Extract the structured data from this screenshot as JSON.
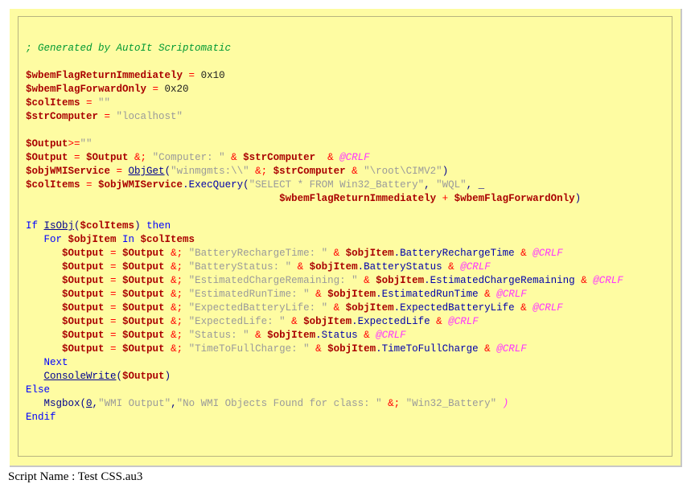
{
  "colors": {
    "panel_background": "#fefca2",
    "comment": "#009933",
    "variable": "#aa0000",
    "operator": "#ff0000",
    "string": "#9a9a9a",
    "keyword": "#0000ff",
    "function": "#000090",
    "property": "#0000aa",
    "macro": "#ff33ff"
  },
  "code_lines": [
    [
      {
        "t": "; Generated by AutoIt Scriptomatic",
        "c": "cm"
      }
    ],
    [],
    [
      {
        "t": "$wbemFlagReturnImmediately",
        "c": "v"
      },
      {
        "t": " = ",
        "c": "o"
      },
      {
        "t": "0x10",
        "c": "n"
      }
    ],
    [
      {
        "t": "$wbemFlagForwardOnly",
        "c": "v"
      },
      {
        "t": " = ",
        "c": "o"
      },
      {
        "t": "0x20",
        "c": "n"
      }
    ],
    [
      {
        "t": "$colItems",
        "c": "v"
      },
      {
        "t": " = ",
        "c": "o"
      },
      {
        "t": "\"\"",
        "c": "s"
      }
    ],
    [
      {
        "t": "$strComputer",
        "c": "v"
      },
      {
        "t": " = ",
        "c": "o"
      },
      {
        "t": "\"localhost\"",
        "c": "s"
      }
    ],
    [],
    [
      {
        "t": "$Output",
        "c": "v"
      },
      {
        "t": ">=",
        "c": "o"
      },
      {
        "t": "\"\"",
        "c": "s"
      }
    ],
    [
      {
        "t": "$Output",
        "c": "v"
      },
      {
        "t": " = ",
        "c": "o"
      },
      {
        "t": "$Output",
        "c": "v"
      },
      {
        "t": " &; ",
        "c": "o"
      },
      {
        "t": "\"Computer: \"",
        "c": "s"
      },
      {
        "t": " & ",
        "c": "o"
      },
      {
        "t": "$strComputer",
        "c": "v"
      },
      {
        "t": "  & ",
        "c": "o"
      },
      {
        "t": "@CRLF",
        "c": "mc"
      }
    ],
    [
      {
        "t": "$objWMIService",
        "c": "v"
      },
      {
        "t": " = ",
        "c": "o"
      },
      {
        "t": "ObjGet",
        "c": "fn"
      },
      {
        "t": "(",
        "c": "p"
      },
      {
        "t": "\"winmgmts:\\\\\"",
        "c": "s"
      },
      {
        "t": " &; ",
        "c": "o"
      },
      {
        "t": "$strComputer",
        "c": "v"
      },
      {
        "t": " & ",
        "c": "o"
      },
      {
        "t": "\"\\root\\CIMV2\"",
        "c": "s"
      },
      {
        "t": ")",
        "c": "p"
      }
    ],
    [
      {
        "t": "$colItems",
        "c": "v"
      },
      {
        "t": " = ",
        "c": "o"
      },
      {
        "t": "$objWMIService",
        "c": "v"
      },
      {
        "t": ".ExecQuery",
        "c": "pr"
      },
      {
        "t": "(",
        "c": "p"
      },
      {
        "t": "\"SELECT * FROM Win32_Battery\"",
        "c": "s"
      },
      {
        "t": ", ",
        "c": "p"
      },
      {
        "t": "\"WQL\"",
        "c": "s"
      },
      {
        "t": ", _",
        "c": "p"
      }
    ],
    [
      {
        "t": "                                          ",
        "c": "n"
      },
      {
        "t": "$wbemFlagReturnImmediately",
        "c": "v"
      },
      {
        "t": " + ",
        "c": "o"
      },
      {
        "t": "$wbemFlagForwardOnly",
        "c": "v"
      },
      {
        "t": ")",
        "c": "p"
      }
    ],
    [],
    [
      {
        "t": "If ",
        "c": "kw"
      },
      {
        "t": "IsObj",
        "c": "fn"
      },
      {
        "t": "(",
        "c": "p"
      },
      {
        "t": "$colItems",
        "c": "v"
      },
      {
        "t": ")",
        "c": "p"
      },
      {
        "t": " then",
        "c": "kw"
      }
    ],
    [
      {
        "t": "   For ",
        "c": "kw"
      },
      {
        "t": "$objItem",
        "c": "v"
      },
      {
        "t": " In ",
        "c": "kw"
      },
      {
        "t": "$colItems",
        "c": "v"
      }
    ],
    [
      {
        "t": "      ",
        "c": "n"
      },
      {
        "t": "$Output",
        "c": "v"
      },
      {
        "t": " = ",
        "c": "o"
      },
      {
        "t": "$Output",
        "c": "v"
      },
      {
        "t": " &; ",
        "c": "o"
      },
      {
        "t": "\"BatteryRechargeTime: \"",
        "c": "s"
      },
      {
        "t": " & ",
        "c": "o"
      },
      {
        "t": "$objItem",
        "c": "v"
      },
      {
        "t": ".BatteryRechargeTime",
        "c": "pr"
      },
      {
        "t": " & ",
        "c": "o"
      },
      {
        "t": "@CRLF",
        "c": "mc"
      }
    ],
    [
      {
        "t": "      ",
        "c": "n"
      },
      {
        "t": "$Output",
        "c": "v"
      },
      {
        "t": " = ",
        "c": "o"
      },
      {
        "t": "$Output",
        "c": "v"
      },
      {
        "t": " &; ",
        "c": "o"
      },
      {
        "t": "\"BatteryStatus: \"",
        "c": "s"
      },
      {
        "t": " & ",
        "c": "o"
      },
      {
        "t": "$objItem",
        "c": "v"
      },
      {
        "t": ".BatteryStatus",
        "c": "pr"
      },
      {
        "t": " & ",
        "c": "o"
      },
      {
        "t": "@CRLF",
        "c": "mc"
      }
    ],
    [
      {
        "t": "      ",
        "c": "n"
      },
      {
        "t": "$Output",
        "c": "v"
      },
      {
        "t": " = ",
        "c": "o"
      },
      {
        "t": "$Output",
        "c": "v"
      },
      {
        "t": " &; ",
        "c": "o"
      },
      {
        "t": "\"EstimatedChargeRemaining: \"",
        "c": "s"
      },
      {
        "t": " & ",
        "c": "o"
      },
      {
        "t": "$objItem",
        "c": "v"
      },
      {
        "t": ".EstimatedChargeRemaining",
        "c": "pr"
      },
      {
        "t": " & ",
        "c": "o"
      },
      {
        "t": "@CRLF",
        "c": "mc"
      }
    ],
    [
      {
        "t": "      ",
        "c": "n"
      },
      {
        "t": "$Output",
        "c": "v"
      },
      {
        "t": " = ",
        "c": "o"
      },
      {
        "t": "$Output",
        "c": "v"
      },
      {
        "t": " &; ",
        "c": "o"
      },
      {
        "t": "\"EstimatedRunTime: \"",
        "c": "s"
      },
      {
        "t": " & ",
        "c": "o"
      },
      {
        "t": "$objItem",
        "c": "v"
      },
      {
        "t": ".EstimatedRunTime",
        "c": "pr"
      },
      {
        "t": " & ",
        "c": "o"
      },
      {
        "t": "@CRLF",
        "c": "mc"
      }
    ],
    [
      {
        "t": "      ",
        "c": "n"
      },
      {
        "t": "$Output",
        "c": "v"
      },
      {
        "t": " = ",
        "c": "o"
      },
      {
        "t": "$Output",
        "c": "v"
      },
      {
        "t": " &; ",
        "c": "o"
      },
      {
        "t": "\"ExpectedBatteryLife: \"",
        "c": "s"
      },
      {
        "t": " & ",
        "c": "o"
      },
      {
        "t": "$objItem",
        "c": "v"
      },
      {
        "t": ".ExpectedBatteryLife",
        "c": "pr"
      },
      {
        "t": " & ",
        "c": "o"
      },
      {
        "t": "@CRLF",
        "c": "mc"
      }
    ],
    [
      {
        "t": "      ",
        "c": "n"
      },
      {
        "t": "$Output",
        "c": "v"
      },
      {
        "t": " = ",
        "c": "o"
      },
      {
        "t": "$Output",
        "c": "v"
      },
      {
        "t": " &; ",
        "c": "o"
      },
      {
        "t": "\"ExpectedLife: \"",
        "c": "s"
      },
      {
        "t": " & ",
        "c": "o"
      },
      {
        "t": "$objItem",
        "c": "v"
      },
      {
        "t": ".ExpectedLife",
        "c": "pr"
      },
      {
        "t": " & ",
        "c": "o"
      },
      {
        "t": "@CRLF",
        "c": "mc"
      }
    ],
    [
      {
        "t": "      ",
        "c": "n"
      },
      {
        "t": "$Output",
        "c": "v"
      },
      {
        "t": " = ",
        "c": "o"
      },
      {
        "t": "$Output",
        "c": "v"
      },
      {
        "t": " &; ",
        "c": "o"
      },
      {
        "t": "\"Status: \"",
        "c": "s"
      },
      {
        "t": " & ",
        "c": "o"
      },
      {
        "t": "$objItem",
        "c": "v"
      },
      {
        "t": ".Status",
        "c": "pr"
      },
      {
        "t": " & ",
        "c": "o"
      },
      {
        "t": "@CRLF",
        "c": "mc"
      }
    ],
    [
      {
        "t": "      ",
        "c": "n"
      },
      {
        "t": "$Output",
        "c": "v"
      },
      {
        "t": " = ",
        "c": "o"
      },
      {
        "t": "$Output",
        "c": "v"
      },
      {
        "t": " &; ",
        "c": "o"
      },
      {
        "t": "\"TimeToFullCharge: \"",
        "c": "s"
      },
      {
        "t": " & ",
        "c": "o"
      },
      {
        "t": "$objItem",
        "c": "v"
      },
      {
        "t": ".TimeToFullCharge",
        "c": "pr"
      },
      {
        "t": " & ",
        "c": "o"
      },
      {
        "t": "@CRLF",
        "c": "mc"
      }
    ],
    [
      {
        "t": "   Next",
        "c": "kw"
      }
    ],
    [
      {
        "t": "   ",
        "c": "n"
      },
      {
        "t": "ConsoleWrite",
        "c": "fn"
      },
      {
        "t": "(",
        "c": "p"
      },
      {
        "t": "$Output",
        "c": "v"
      },
      {
        "t": ")",
        "c": "p"
      }
    ],
    [
      {
        "t": "Else",
        "c": "kw"
      }
    ],
    [
      {
        "t": "   Msgbox",
        "c": "p"
      },
      {
        "t": "(",
        "c": "p"
      },
      {
        "t": "0",
        "c": "fn"
      },
      {
        "t": ",",
        "c": "p"
      },
      {
        "t": "\"WMI Output\"",
        "c": "s"
      },
      {
        "t": ",",
        "c": "p"
      },
      {
        "t": "\"No WMI Objects Found for class: \"",
        "c": "s"
      },
      {
        "t": " &; ",
        "c": "o"
      },
      {
        "t": "\"Win32_Battery\"",
        "c": "s"
      },
      {
        "t": " )",
        "c": "mc"
      }
    ],
    [
      {
        "t": "Endif",
        "c": "kw"
      }
    ]
  ],
  "footer": {
    "script_name": "Script Name : Test CSS.au3"
  }
}
